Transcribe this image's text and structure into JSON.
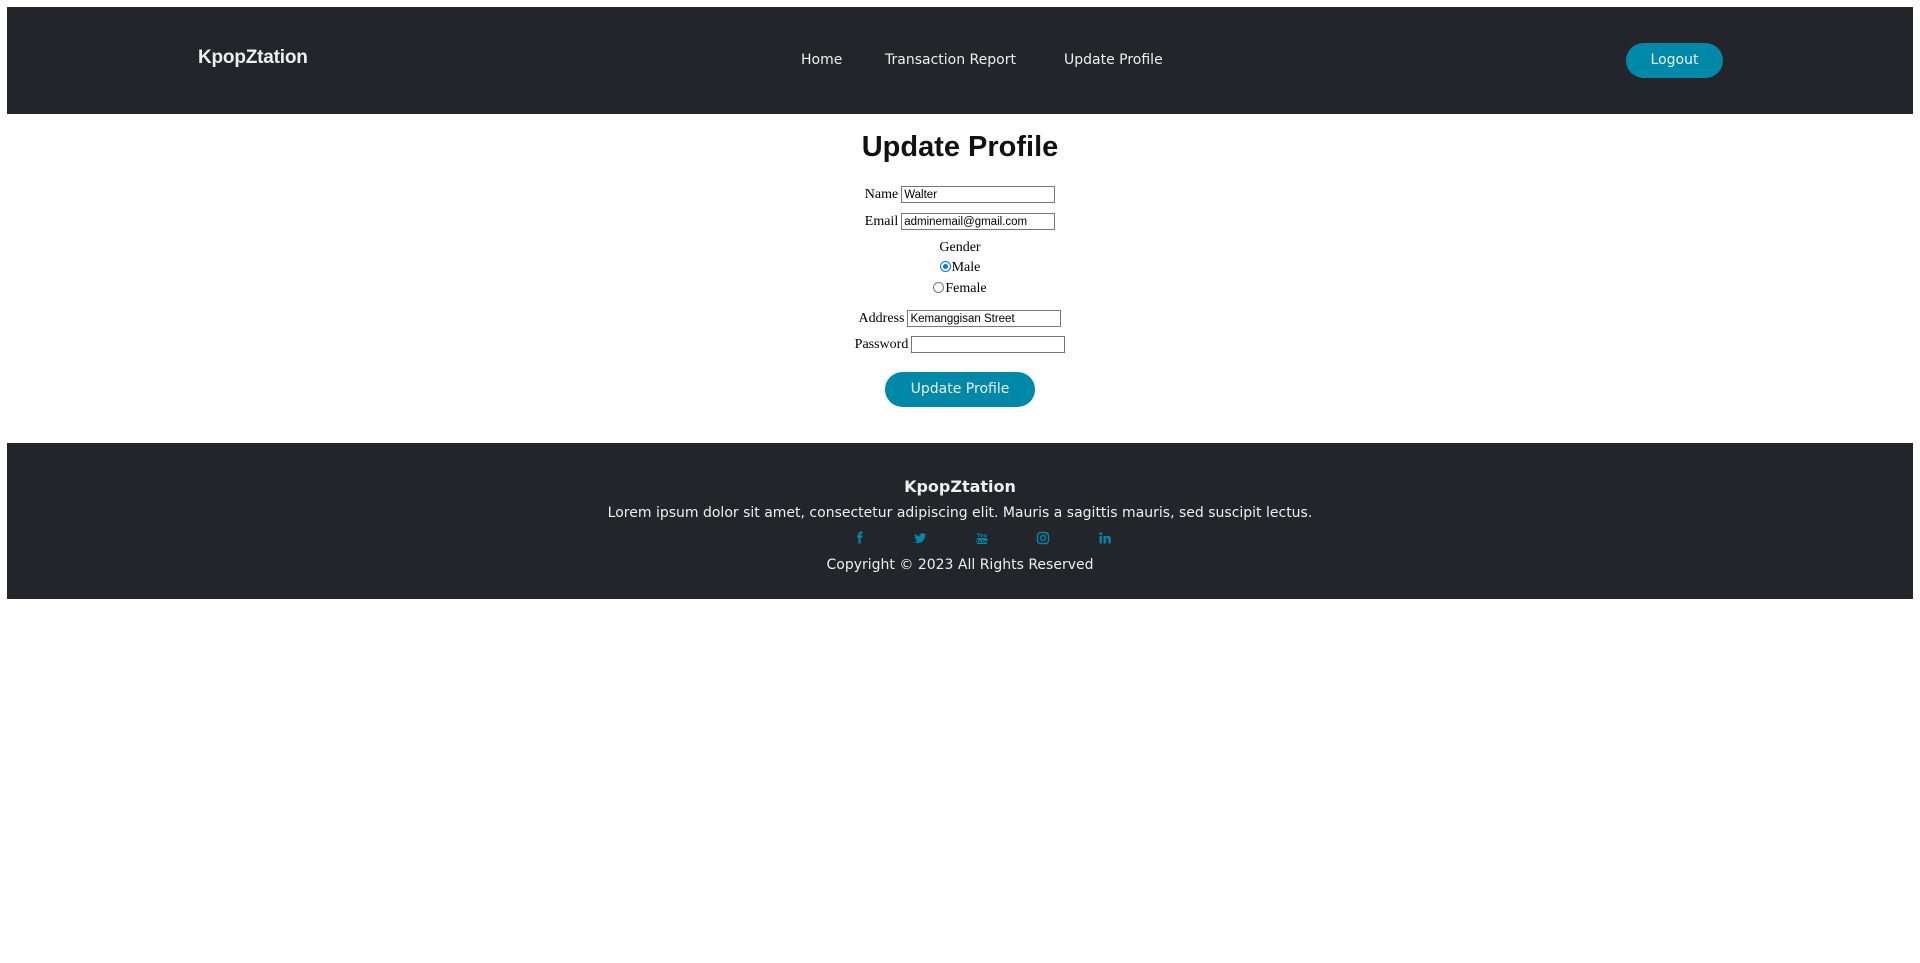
{
  "header": {
    "brand": "KpopZtation",
    "nav": [
      {
        "label": "Home"
      },
      {
        "label": "Transaction Report"
      },
      {
        "label": "Update Profile"
      }
    ],
    "logout_label": "Logout"
  },
  "main": {
    "title": "Update Profile",
    "form": {
      "name_label": "Name",
      "name_value": "Walter",
      "email_label": "Email",
      "email_value": "adminemail@gmail.com",
      "gender_label": "Gender",
      "gender_options": [
        {
          "label": "Male",
          "checked": true
        },
        {
          "label": "Female",
          "checked": false
        }
      ],
      "address_label": "Address",
      "address_value": "Kemanggisan Street",
      "password_label": "Password",
      "password_value": "",
      "submit_label": "Update Profile"
    }
  },
  "footer": {
    "brand": "KpopZtation",
    "description": "Lorem ipsum dolor sit amet, consectetur adipiscing elit. Mauris a sagittis mauris, sed suscipit lectus.",
    "socials": [
      {
        "icon": "facebook-icon"
      },
      {
        "icon": "twitter-icon"
      },
      {
        "icon": "youtube-icon"
      },
      {
        "icon": "instagram-icon"
      },
      {
        "icon": "linkedin-icon"
      }
    ],
    "copyright": "Copyright © 2023 All Rights Reserved"
  },
  "colors": {
    "header_bg": "#24252a",
    "accent": "#0088a9",
    "text_light": "#edf0f1"
  }
}
